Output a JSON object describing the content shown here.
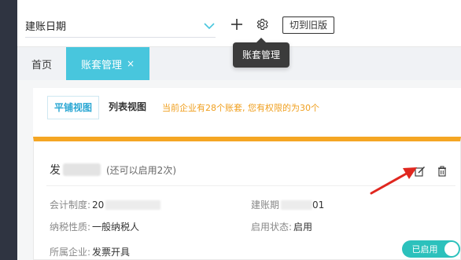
{
  "header": {
    "date_select_value": "建账日期",
    "switch_button_label": "切到旧版",
    "tooltip": "账套管理"
  },
  "page_tabs": {
    "home_label": "首页",
    "active_label": "账套管理",
    "active_close": "×"
  },
  "view_tabs": {
    "tiled": "平铺视图",
    "list": "列表视图",
    "notice": "当前企业有28个账套, 您有权限的为30个"
  },
  "card": {
    "title_prefix": "发",
    "title_suffix": "(还可以启用2次)",
    "accounting_system_label": "会计制度:",
    "accounting_system_value_prefix": "20",
    "build_date_label": "建账期",
    "build_date_value_suffix": "01",
    "taxpayer_label": "纳税性质:",
    "taxpayer_value": "一般纳税人",
    "enable_status_label": "启用状态:",
    "enable_status_value": "启用",
    "company_label": "所属企业:",
    "company_value": "发票开具",
    "toggle_label": "已启用"
  },
  "colors": {
    "accent_teal": "#48c6dd",
    "accent_orange": "#f5a623",
    "toggle_on": "#2cc1bc",
    "arrow_red": "#e0271f"
  }
}
